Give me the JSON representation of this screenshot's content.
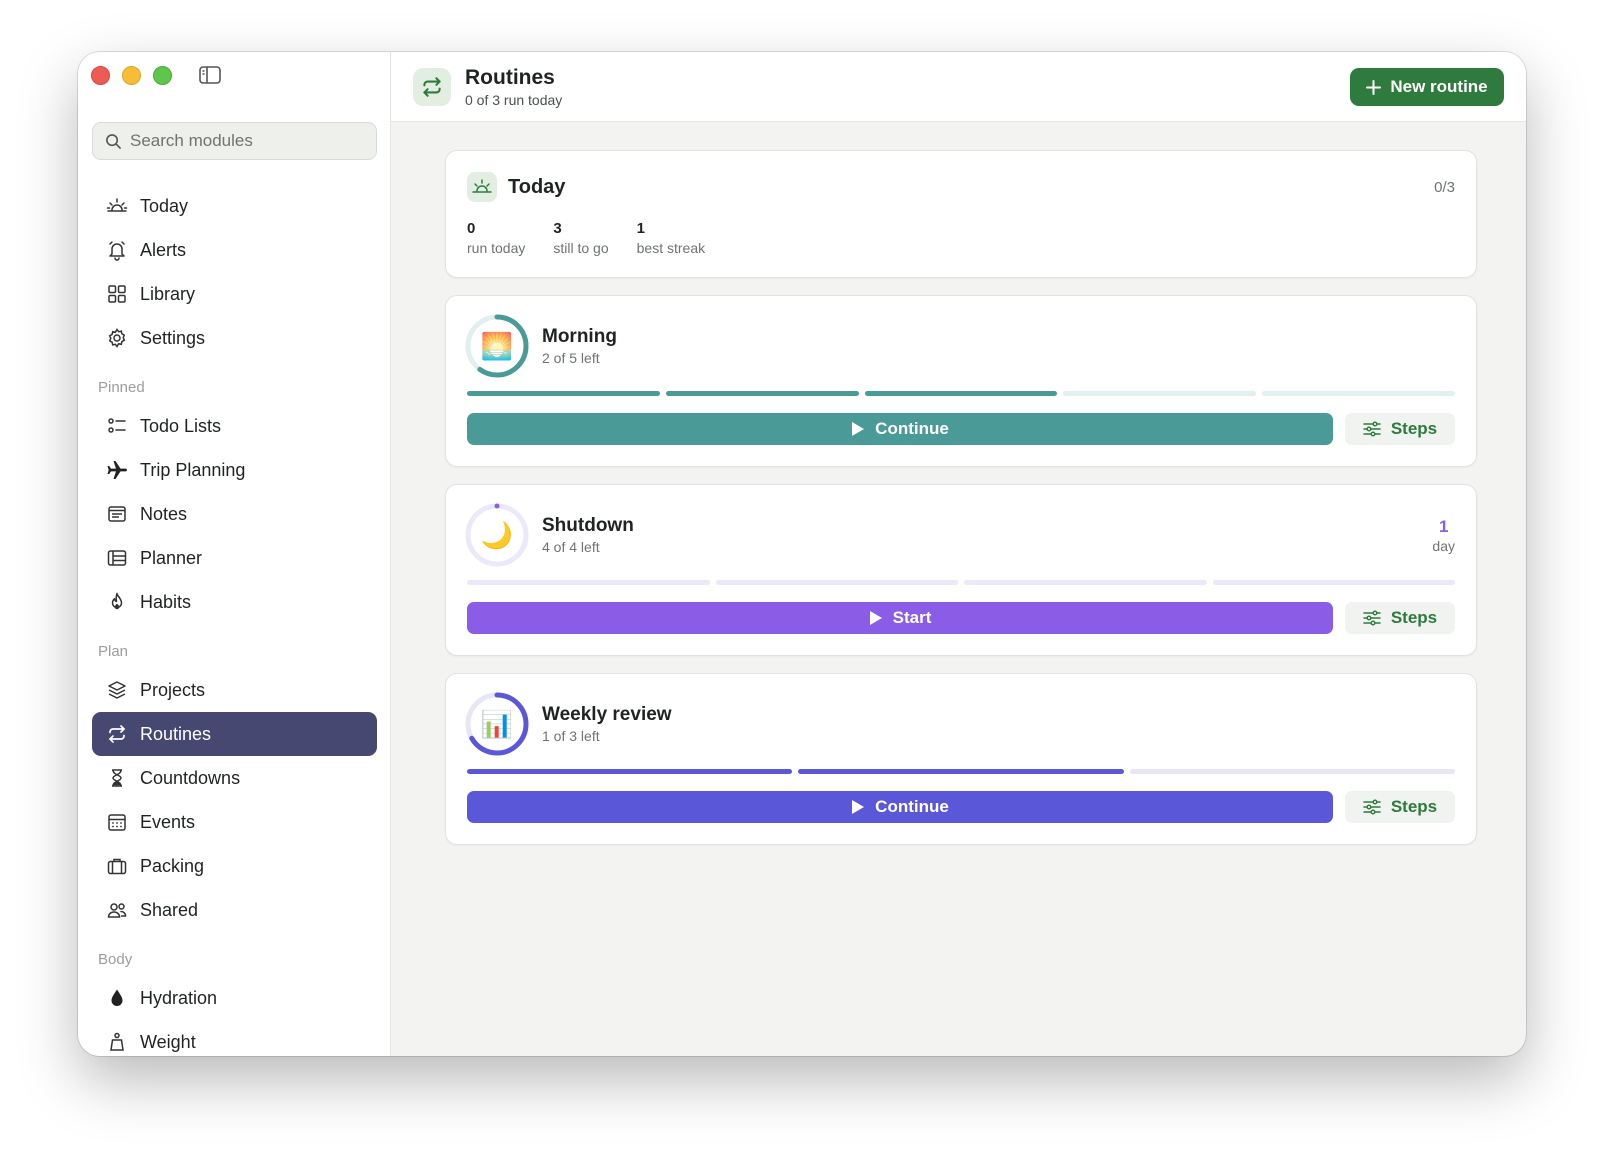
{
  "sidebar": {
    "search_placeholder": "Search modules",
    "top_items": [
      {
        "label": "Today",
        "icon": "sunrise-icon"
      },
      {
        "label": "Alerts",
        "icon": "bell-icon"
      },
      {
        "label": "Library",
        "icon": "grid-icon"
      },
      {
        "label": "Settings",
        "icon": "gear-icon"
      }
    ],
    "sections": [
      {
        "label": "Pinned",
        "items": [
          {
            "label": "Todo Lists",
            "icon": "checklist-icon"
          },
          {
            "label": "Trip Planning",
            "icon": "airplane-icon"
          },
          {
            "label": "Notes",
            "icon": "note-icon"
          },
          {
            "label": "Planner",
            "icon": "planner-icon"
          },
          {
            "label": "Habits",
            "icon": "flame-icon"
          }
        ]
      },
      {
        "label": "Plan",
        "items": [
          {
            "label": "Projects",
            "icon": "layers-icon"
          },
          {
            "label": "Routines",
            "icon": "repeat-icon",
            "active": true
          },
          {
            "label": "Countdowns",
            "icon": "hourglass-icon"
          },
          {
            "label": "Events",
            "icon": "calendar-icon"
          },
          {
            "label": "Packing",
            "icon": "suitcase-icon"
          },
          {
            "label": "Shared",
            "icon": "people-icon"
          }
        ]
      },
      {
        "label": "Body",
        "items": [
          {
            "label": "Hydration",
            "icon": "drop-icon"
          },
          {
            "label": "Weight",
            "icon": "scale-icon"
          }
        ]
      }
    ]
  },
  "header": {
    "title": "Routines",
    "subtitle": "0 of 3 run today",
    "new_button": "New routine"
  },
  "today": {
    "title": "Today",
    "count": "0/3",
    "stats": [
      {
        "value": "0",
        "label": "run today"
      },
      {
        "value": "3",
        "label": "still to go"
      },
      {
        "value": "1",
        "label": "best streak"
      }
    ]
  },
  "routines": [
    {
      "name": "Morning",
      "left": "2 of 5 left",
      "emoji": "🌅",
      "total_steps": 5,
      "done_steps": 3,
      "progress": 0.6,
      "color": "#4a9a98",
      "track": "#e3eeee",
      "action": "Continue",
      "steps_label": "Steps",
      "streak_value": "",
      "streak_label": ""
    },
    {
      "name": "Shutdown",
      "left": "4 of 4 left",
      "emoji": "🌙",
      "total_steps": 4,
      "done_steps": 0,
      "progress": 0.0,
      "color": "#8b5ce6",
      "track": "#ece8fa",
      "action": "Start",
      "steps_label": "Steps",
      "streak_value": "1",
      "streak_label": "day"
    },
    {
      "name": "Weekly review",
      "left": "1 of 3 left",
      "emoji": "📊",
      "total_steps": 3,
      "done_steps": 2,
      "progress": 0.667,
      "color": "#5b57d9",
      "track": "#e6e6f7",
      "action": "Continue",
      "steps_label": "Steps",
      "streak_value": "",
      "streak_label": ""
    }
  ],
  "colors": {
    "accent_green": "#2f7a3d",
    "sidebar_active": "#464871"
  }
}
